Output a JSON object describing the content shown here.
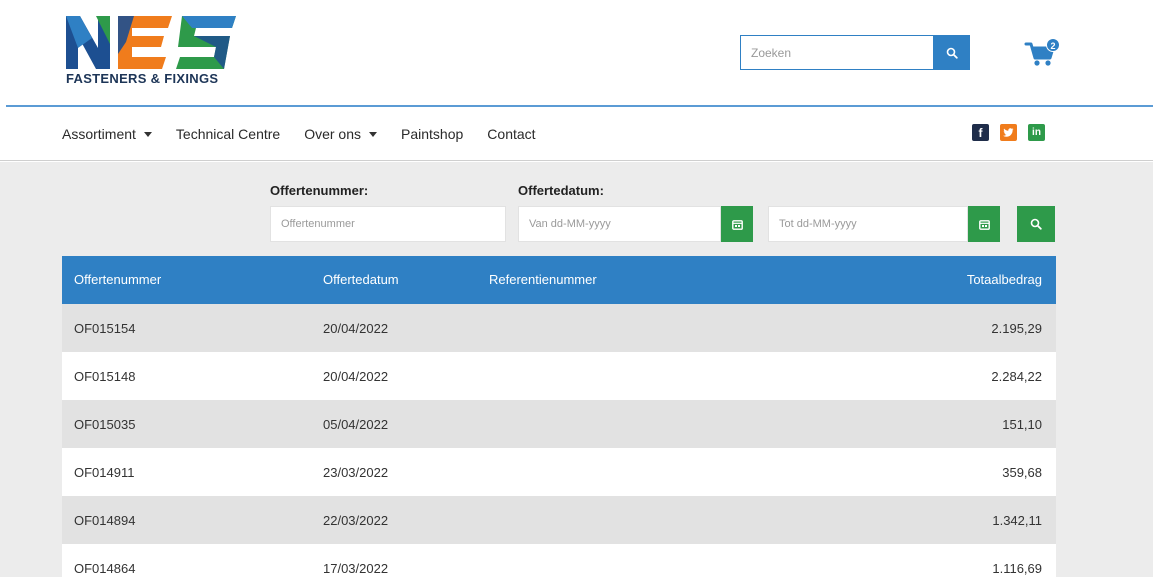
{
  "brand": {
    "logo_letters": "NES",
    "logo_subtitle": "FASTENERS & FIXINGS",
    "colors": {
      "blue": "#2f80c4",
      "navy": "#1d3557",
      "orange": "#f07c1c",
      "green": "#2e9a4a"
    }
  },
  "header": {
    "search_placeholder": "Zoeken",
    "search_icon": "search-icon",
    "cart_icon": "cart-icon",
    "cart_count": "2"
  },
  "nav": {
    "items": [
      {
        "label": "Assortiment",
        "has_dropdown": true
      },
      {
        "label": "Technical Centre",
        "has_dropdown": false
      },
      {
        "label": "Over ons",
        "has_dropdown": true
      },
      {
        "label": "Paintshop",
        "has_dropdown": false
      },
      {
        "label": "Contact",
        "has_dropdown": false
      }
    ],
    "socials": [
      {
        "name": "facebook-icon",
        "glyph": "f"
      },
      {
        "name": "twitter-icon",
        "glyph": "t"
      },
      {
        "name": "linkedin-icon",
        "glyph": "in"
      }
    ]
  },
  "filters": {
    "offer_number_label": "Offertenummer:",
    "offer_number_placeholder": "Offertenummer",
    "offer_date_label": "Offertedatum:",
    "date_from_placeholder": "Van dd-MM-yyyy",
    "date_to_placeholder": "Tot dd-MM-yyyy"
  },
  "table": {
    "headers": [
      "Offertenummer",
      "Offertedatum",
      "Referentienummer",
      "Totaalbedrag"
    ],
    "rows": [
      {
        "number": "OF015154",
        "date": "20/04/2022",
        "reference": "",
        "total": "2.195,29"
      },
      {
        "number": "OF015148",
        "date": "20/04/2022",
        "reference": "",
        "total": "2.284,22"
      },
      {
        "number": "OF015035",
        "date": "05/04/2022",
        "reference": "",
        "total": "151,10"
      },
      {
        "number": "OF014911",
        "date": "23/03/2022",
        "reference": "",
        "total": "359,68"
      },
      {
        "number": "OF014894",
        "date": "22/03/2022",
        "reference": "",
        "total": "1.342,11"
      },
      {
        "number": "OF014864",
        "date": "17/03/2022",
        "reference": "",
        "total": "1.116,69"
      }
    ]
  }
}
